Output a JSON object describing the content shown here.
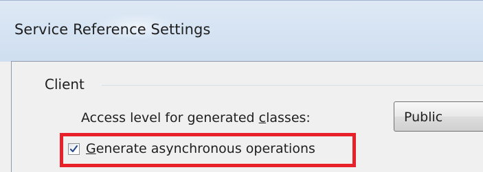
{
  "window": {
    "title": "Service Reference Settings"
  },
  "client_group": {
    "label": "Client",
    "access_level": {
      "label_prefix": "Access level for generated ",
      "label_mnemonic": "c",
      "label_suffix": "lasses:",
      "value": "Public"
    },
    "async_option": {
      "label_mnemonic": "G",
      "label_suffix": "enerate asynchronous operations",
      "checked": true
    }
  },
  "annotation": {
    "highlight_color": "#e8202a"
  }
}
